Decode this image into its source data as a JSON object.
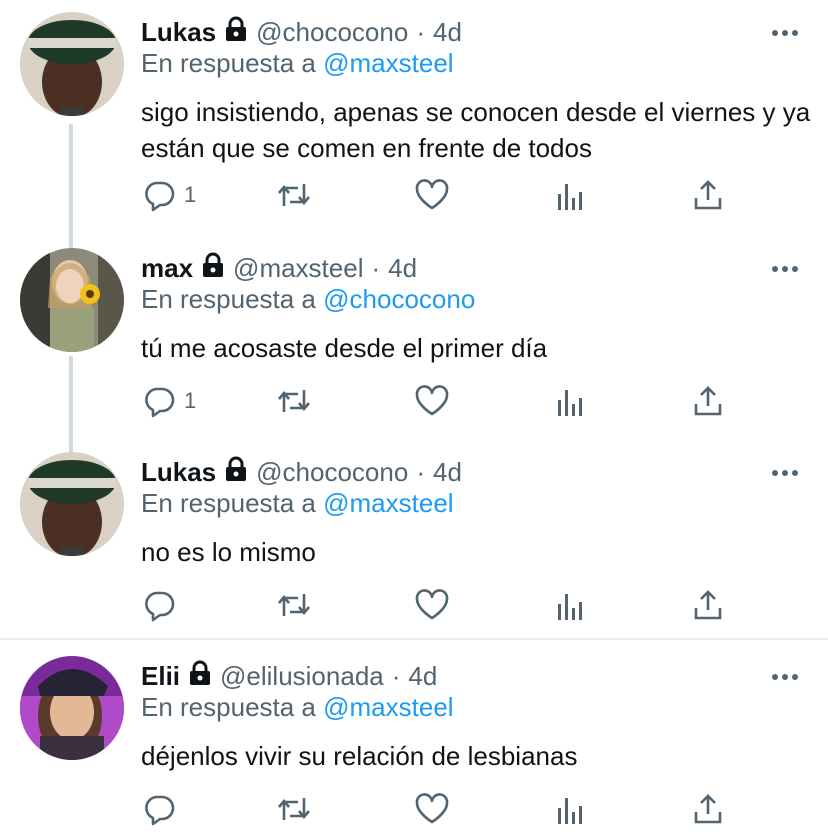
{
  "tweets": [
    {
      "name": "Lukas",
      "handle": "@chococono",
      "time": "4d",
      "reply_prefix": "En respuesta a",
      "reply_to": "@maxsteel",
      "text": "sigo insistiendo, apenas se conocen desde el viernes y ya están que se comen en frente de todos",
      "reply_count": "1"
    },
    {
      "name": "max",
      "handle": "@maxsteel",
      "time": "4d",
      "reply_prefix": "En respuesta a",
      "reply_to": "@chococono",
      "text": "tú me acosaste desde el primer día",
      "reply_count": "1"
    },
    {
      "name": "Lukas",
      "handle": "@chococono",
      "time": "4d",
      "reply_prefix": "En respuesta a",
      "reply_to": "@maxsteel",
      "text": "no es lo mismo",
      "reply_count": ""
    },
    {
      "name": "Elii",
      "handle": "@elilusionada",
      "time": "4d",
      "reply_prefix": "En respuesta a",
      "reply_to": "@maxsteel",
      "text": "déjenlos vivir su relación de lesbianas",
      "reply_count": ""
    }
  ],
  "separator": "·",
  "colors": {
    "link": "#1d9bf0",
    "secondary_text": "#536471",
    "thread_line": "#cfd9de"
  }
}
